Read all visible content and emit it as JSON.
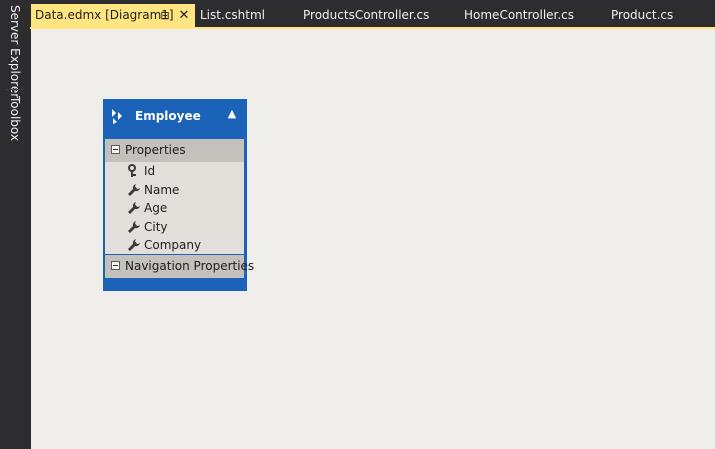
{
  "side_tabs": {
    "server_explorer": "Server Explorer",
    "toolbox": "Toolbox"
  },
  "tabs": [
    {
      "label": "Data.edmx [Diagram1]",
      "active": true
    },
    {
      "label": "List.cshtml",
      "active": false
    },
    {
      "label": "ProductsController.cs",
      "active": false
    },
    {
      "label": "HomeController.cs",
      "active": false
    },
    {
      "label": "Product.cs",
      "active": false
    }
  ],
  "tab_icons": {
    "pin": "pin-icon",
    "close": "close-icon"
  },
  "entity": {
    "name": "Employee",
    "icon": "entity-icon",
    "collapse_icon": "chevron-up-icon",
    "properties_section": "Properties",
    "properties": [
      {
        "name": "Id",
        "icon": "key-icon"
      },
      {
        "name": "Name",
        "icon": "wrench-icon"
      },
      {
        "name": "Age",
        "icon": "wrench-icon"
      },
      {
        "name": "City",
        "icon": "wrench-icon"
      },
      {
        "name": "Company",
        "icon": "wrench-icon"
      }
    ],
    "navigation_section": "Navigation Properties"
  },
  "colors": {
    "active_tab": "#ffe57f",
    "entity_header": "#1a63b8",
    "canvas": "#efeeeb",
    "chrome": "#2d2d30"
  }
}
